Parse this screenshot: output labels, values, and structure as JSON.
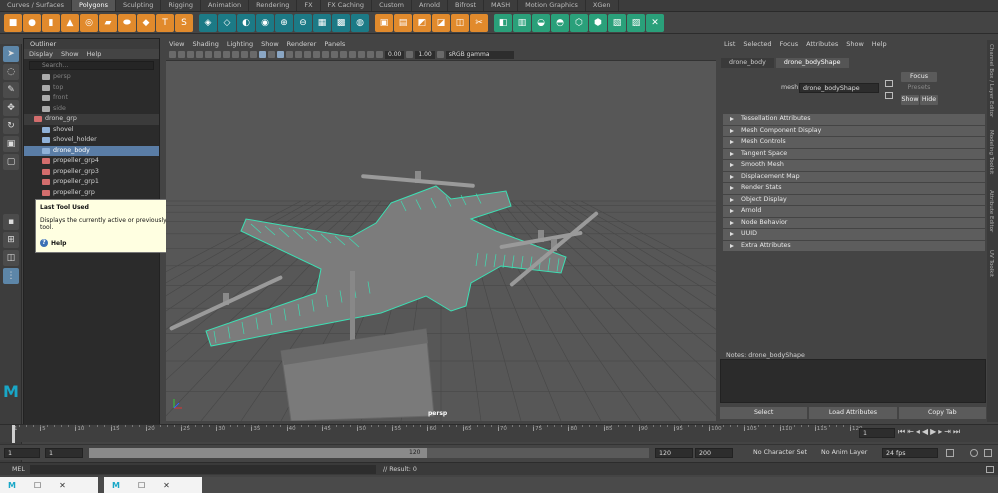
{
  "shelf": {
    "tabs": [
      "Curves / Surfaces",
      "Polygons",
      "Sculpting",
      "Rigging",
      "Animation",
      "Rendering",
      "FX",
      "FX Caching",
      "Custom",
      "Arnold",
      "Bifrost",
      "MASH",
      "Motion Graphics",
      "XGen"
    ],
    "active_tab": "Polygons"
  },
  "outliner": {
    "title": "Outliner",
    "menu": [
      "Display",
      "Show",
      "Help"
    ],
    "search_placeholder": "Search...",
    "items": [
      {
        "label": "persp",
        "type": "camera",
        "indent": 1,
        "style": "dim"
      },
      {
        "label": "top",
        "type": "camera",
        "indent": 1,
        "style": "dim"
      },
      {
        "label": "front",
        "type": "camera",
        "indent": 1,
        "style": "dim"
      },
      {
        "label": "side",
        "type": "camera",
        "indent": 1,
        "style": "dim"
      },
      {
        "label": "drone_grp",
        "type": "group",
        "indent": 0,
        "style": "grp"
      },
      {
        "label": "shovel",
        "type": "mesh",
        "indent": 1,
        "style": "normal"
      },
      {
        "label": "shovel_holder",
        "type": "mesh",
        "indent": 1,
        "style": "normal"
      },
      {
        "label": "drone_body",
        "type": "mesh",
        "indent": 1,
        "style": "hl"
      },
      {
        "label": "propeller_grp4",
        "type": "group",
        "indent": 1,
        "style": "normal"
      },
      {
        "label": "propeller_grp3",
        "type": "group",
        "indent": 1,
        "style": "normal"
      },
      {
        "label": "propeller_grp1",
        "type": "group",
        "indent": 1,
        "style": "normal"
      },
      {
        "label": "propeller_grp",
        "type": "group",
        "indent": 1,
        "style": "normal"
      }
    ]
  },
  "tooltip": {
    "title": "Last Tool Used",
    "body": "Displays the currently active or previously selected tool.",
    "help": "Help"
  },
  "viewport": {
    "menu": [
      "View",
      "Shading",
      "Lighting",
      "Show",
      "Renderer",
      "Panels"
    ],
    "field1": "0.00",
    "field2": "1.00",
    "colorspace": "sRGB gamma",
    "camera_label": "persp",
    "wire_color": "#3de0b4",
    "grid_color": "#474747",
    "bg_color": "#575757"
  },
  "attribute_editor": {
    "menu": [
      "List",
      "Selected",
      "Focus",
      "Attributes",
      "Show",
      "Help"
    ],
    "tabs": [
      "drone_body",
      "drone_bodyShape"
    ],
    "active_tab": "drone_bodyShape",
    "mesh_label": "mesh:",
    "mesh_value": "drone_bodyShape",
    "focus": "Focus",
    "presets": "Presets",
    "show": "Show",
    "hide": "Hide",
    "sections": [
      "Tessellation Attributes",
      "Mesh Component Display",
      "Mesh Controls",
      "Tangent Space",
      "Smooth Mesh",
      "Displacement Map",
      "Render Stats",
      "Object Display",
      "Arnold",
      "Node Behavior",
      "UUID",
      "Extra Attributes"
    ],
    "notes_label": "Notes:  drone_bodyShape",
    "buttons": [
      "Select",
      "Load Attributes",
      "Copy Tab"
    ]
  },
  "side_tabs": [
    "Channel Box / Layer Editor",
    "Modeling Toolkit",
    "Attribute Editor",
    "UV Toolkit"
  ],
  "timeline": {
    "ticks": [
      1,
      5,
      10,
      15,
      20,
      25,
      30,
      35,
      40,
      45,
      50,
      55,
      60,
      65,
      70,
      75,
      80,
      85,
      90,
      95,
      100,
      105,
      110,
      115,
      120
    ],
    "current_frame": "1"
  },
  "range": {
    "start": "1",
    "start2": "1",
    "bar_start": "1",
    "bar_end": "120",
    "end": "120",
    "end2": "200",
    "character_set": "No Character Set",
    "anim_layer": "No Anim Layer",
    "fps": "24 fps"
  },
  "command": {
    "lang": "MEL",
    "result": "// Result: 0"
  }
}
